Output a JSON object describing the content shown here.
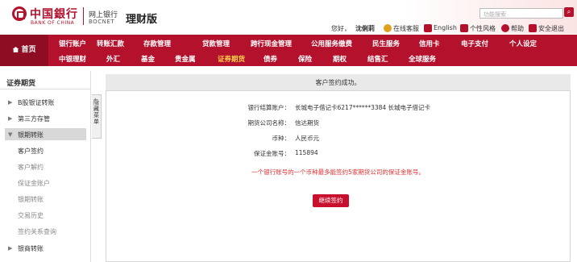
{
  "brand": {
    "cn": "中国銀行",
    "en": "BANK OF CHINA",
    "netbank": "网上银行",
    "bocnet": "BOCNET",
    "product": "理财版",
    "color": "#b3112c"
  },
  "search": {
    "placeholder": "功能搜索"
  },
  "userbar": {
    "greeting": "您好，",
    "user": "沈俐莉",
    "online": "在线客服",
    "english": "English",
    "personal_style": "个性风格",
    "help": "帮助",
    "logout": "安全退出"
  },
  "nav": {
    "home": "首页",
    "row1": [
      "银行账户",
      "转账汇款",
      "存款管理",
      "贷款管理",
      "跨行现金管理",
      "公用服务缴费",
      "民生服务",
      "信用卡",
      "电子支付",
      "个人设定"
    ],
    "row2": [
      "中银理财",
      "外汇",
      "基金",
      "贵金属",
      "证券期货",
      "债券",
      "保险",
      "期权",
      "结售汇",
      "全球服务"
    ],
    "active": "证券期货"
  },
  "sidebar": {
    "title": "证券期货",
    "items": [
      "B股银证转账",
      "第三方存管",
      "银期转账",
      "银商转账"
    ],
    "subitems": [
      "客户签约",
      "客户解约",
      "保证金账户",
      "银期转账",
      "交易历史",
      "签约关系查询"
    ],
    "collapse_label": "隐藏菜单"
  },
  "main": {
    "message": "客户签约成功。",
    "fields": [
      {
        "label": "银行结算账户：",
        "value": "长城电子借记卡6217******3384 长城电子借记卡"
      },
      {
        "label": "期货公司名称：",
        "value": "信达期货"
      },
      {
        "label": "币种：",
        "value": "人民币元"
      },
      {
        "label": "保证金账号：",
        "value": "115894"
      }
    ],
    "note": "一个银行账号的一个币种最多能签约5家期货公司的保证金账号。",
    "continue_button": "继续签约"
  }
}
